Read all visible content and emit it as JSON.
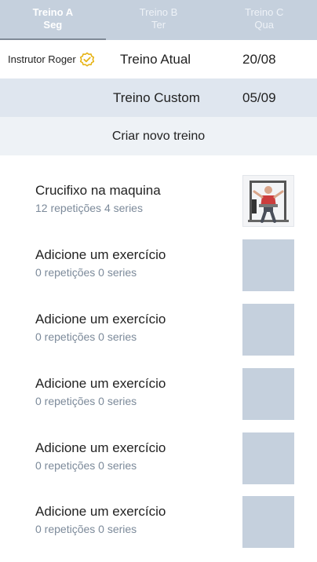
{
  "tabs": [
    {
      "name": "Treino A",
      "day": "Seg",
      "active": true
    },
    {
      "name": "Treino B",
      "day": "Ter",
      "active": false
    },
    {
      "name": "Treino C",
      "day": "Qua",
      "active": false
    }
  ],
  "instructor": {
    "label": "Instrutor Roger",
    "badge_icon": "verified-badge-icon"
  },
  "workouts": [
    {
      "name": "Treino Atual",
      "date": "20/08"
    },
    {
      "name": "Treino Custom",
      "date": "05/09"
    }
  ],
  "create_label": "Criar novo treino",
  "exercises": [
    {
      "title": "Crucifixo na maquina",
      "subtitle": "12 repetições 4 series",
      "has_image": true
    },
    {
      "title": "Adicione um exercício",
      "subtitle": "0 repetições 0 series",
      "has_image": false
    },
    {
      "title": "Adicione um exercício",
      "subtitle": "0 repetições 0 series",
      "has_image": false
    },
    {
      "title": "Adicione um exercício",
      "subtitle": "0 repetições 0 series",
      "has_image": false
    },
    {
      "title": "Adicione um exercício",
      "subtitle": "0 repetições 0 series",
      "has_image": false
    },
    {
      "title": "Adicione um exercício",
      "subtitle": "0 repetições 0 series",
      "has_image": false
    }
  ],
  "colors": {
    "accent": "#c5d0dd",
    "badge": "#e7b416",
    "subtitle": "#7c8a9a"
  }
}
